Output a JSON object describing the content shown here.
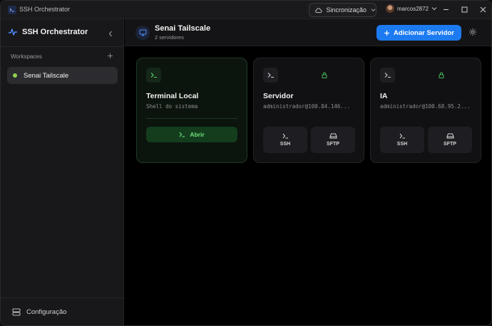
{
  "titlebar": {
    "app_title": "SSH Orchestrator",
    "sync_label": "Sincronização",
    "username": "marcos2872"
  },
  "sidebar": {
    "brand": "SSH Orchestrator",
    "workspaces_label": "Workspaces",
    "items": [
      {
        "label": "Senai Tailscale",
        "status_color": "#8fd14f"
      }
    ],
    "config_label": "Configuração"
  },
  "header": {
    "title": "Senai Tailscale",
    "subtitle": "2 servidores",
    "add_button_label": "Adicionar Servidor"
  },
  "cards": [
    {
      "title": "Terminal Local",
      "subtitle": "Shell do sistema",
      "action_label": "Abrir"
    },
    {
      "title": "Servidor",
      "subtitle": "administrador@100.84.146...",
      "ssh_label": "SSH",
      "sftp_label": "SFTP"
    },
    {
      "title": "IA",
      "subtitle": "administrador@100.68.95.2...",
      "ssh_label": "SSH",
      "sftp_label": "SFTP"
    }
  ],
  "colors": {
    "accent": "#1d7bf2",
    "success": "#6ee07a"
  }
}
